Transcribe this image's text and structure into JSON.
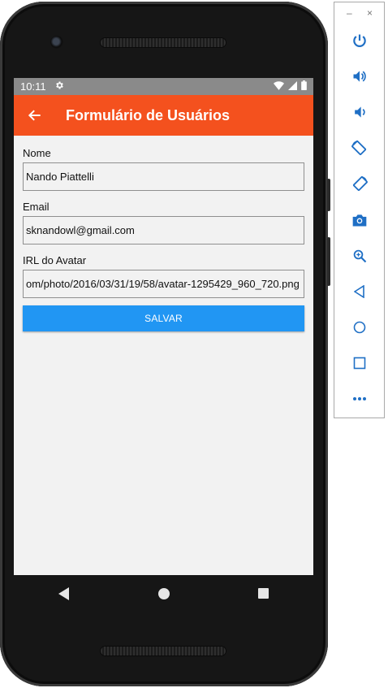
{
  "device": {
    "status_bar": {
      "time": "10:11"
    },
    "nav_bar": {
      "buttons": [
        "back",
        "home",
        "recents"
      ]
    }
  },
  "app_bar": {
    "title": "Formulário de Usuários"
  },
  "form": {
    "fields": [
      {
        "label": "Nome",
        "value": "Nando Piattelli"
      },
      {
        "label": "Email",
        "value": "sknandowl@gmail.com"
      },
      {
        "label": "IRL do Avatar",
        "value": "om/photo/2016/03/31/19/58/avatar-1295429_960_720.png"
      }
    ],
    "save_label": "SALVAR"
  },
  "emulator_toolbar": {
    "window": {
      "minimize": "–",
      "close": "×"
    },
    "tools": [
      "power-icon",
      "volume-up-icon",
      "volume-down-icon",
      "rotate-left-icon",
      "rotate-right-icon",
      "screenshot-icon",
      "zoom-icon",
      "back-icon",
      "home-icon",
      "overview-icon",
      "more-icon"
    ]
  },
  "colors": {
    "app_bar": "#f4511e",
    "status_bar": "#8a8a8a",
    "button": "#2196f3",
    "emulator_icons": "#1f6fc5"
  }
}
